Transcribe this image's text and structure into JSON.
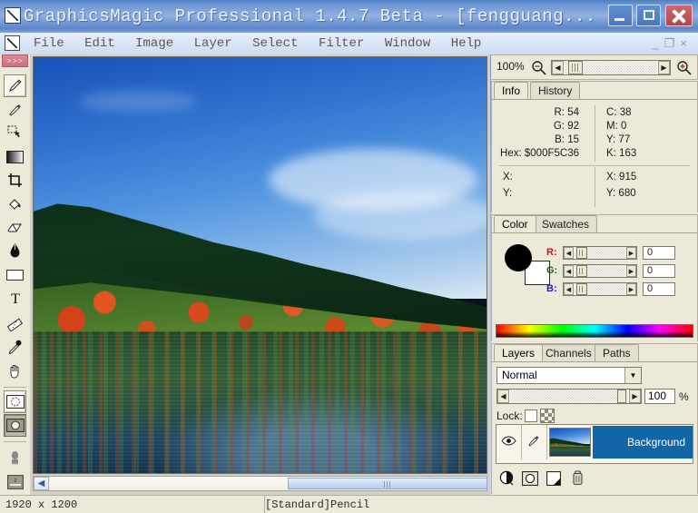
{
  "window": {
    "title": "GraphicsMagic Professional 1.4.7 Beta - [fengguang...",
    "minimize_label": "Minimize",
    "maximize_label": "Maximize",
    "close_label": "Close",
    "titlebar_color": "#6e96d4"
  },
  "menubar": {
    "items": [
      {
        "label": "File",
        "accel": "F"
      },
      {
        "label": "Edit",
        "accel": "E"
      },
      {
        "label": "Image",
        "accel": "I"
      },
      {
        "label": "Layer",
        "accel": "L"
      },
      {
        "label": "Select",
        "accel": "S"
      },
      {
        "label": "Filter",
        "accel": "t"
      },
      {
        "label": "Window",
        "accel": "W"
      },
      {
        "label": "Help",
        "accel": "H"
      }
    ],
    "mdi_minimize": "_",
    "mdi_restore": "❐",
    "mdi_close": "×"
  },
  "toolbox": {
    "grip_label": ">>>",
    "tools": [
      {
        "name": "pencil-tool",
        "icon": "pencil-icon",
        "selected": true
      },
      {
        "name": "brush-tool",
        "icon": "brush-icon",
        "selected": false
      },
      {
        "name": "move-tool",
        "icon": "move-icon",
        "selected": false
      },
      {
        "name": "gradient-tool",
        "icon": "gradient-icon",
        "selected": false
      },
      {
        "name": "crop-tool",
        "icon": "crop-icon",
        "selected": false
      },
      {
        "name": "paint-bucket-tool",
        "icon": "paint-bucket-icon",
        "selected": false
      },
      {
        "name": "eraser-tool",
        "icon": "eraser-icon",
        "selected": false
      },
      {
        "name": "blur-tool",
        "icon": "blur-drop-icon",
        "selected": false
      },
      {
        "name": "rectangle-tool",
        "icon": "rectangle-icon",
        "selected": false
      },
      {
        "name": "text-tool",
        "icon": "text-t-icon",
        "selected": false
      },
      {
        "name": "measure-tool",
        "icon": "ruler-icon",
        "selected": false
      },
      {
        "name": "eyedropper-tool",
        "icon": "eyedropper-icon",
        "selected": false
      },
      {
        "name": "hand-tool",
        "icon": "hand-icon",
        "selected": false
      },
      {
        "name": "quickmask-off-tool",
        "icon": "quickmask-off-icon",
        "selected": true
      },
      {
        "name": "quickmask-on-tool",
        "icon": "quickmask-on-icon",
        "pressed": true
      },
      {
        "name": "screenmode-tool",
        "icon": "screen-mode-icon",
        "selected": false
      },
      {
        "name": "jumpto-tool",
        "icon": "jump-to-app-icon",
        "selected": false
      }
    ]
  },
  "document": {
    "image_name": "fengguang",
    "scroll_h_value": 62
  },
  "zoom_bar": {
    "percent": "100%",
    "zoom_out_icon": "magnifier-minus-icon",
    "zoom_in_icon": "magnifier-plus-icon",
    "slider_value": 12
  },
  "info_panel": {
    "tabs": [
      {
        "label": "Info",
        "active": true
      },
      {
        "label": "History",
        "active": false
      }
    ],
    "rgb": {
      "r_label": "R: 54",
      "g_label": "G: 92",
      "b_label": "B: 15",
      "hex_label": "Hex: $000F5C36"
    },
    "cmyk": {
      "c_label": "C: 38",
      "m_label": "M: 0",
      "y_label": "Y: 77",
      "k_label": "K: 163"
    },
    "coords_left": {
      "x_label": "X:",
      "y_label": "Y:"
    },
    "coords_right": {
      "x_label": "X: 915",
      "y_label": "Y: 680"
    }
  },
  "color_panel": {
    "tabs": [
      {
        "label": "Color",
        "active": true
      },
      {
        "label": "Swatches",
        "active": false
      }
    ],
    "foreground_color": "#000000",
    "background_color": "#ffffff",
    "channels": [
      {
        "label": "R:",
        "value": "0",
        "color": "#c01818"
      },
      {
        "label": "G:",
        "value": "0",
        "color": "#1a6b1a"
      },
      {
        "label": "B:",
        "value": "0",
        "color": "#2222b8"
      }
    ]
  },
  "layers_panel": {
    "tabs": [
      {
        "label": "Layers",
        "active": true
      },
      {
        "label": "Channels",
        "active": false
      },
      {
        "label": "Paths",
        "active": false
      }
    ],
    "blend_mode": "Normal",
    "blend_arrow": "▼",
    "opacity_value": "100",
    "opacity_unit": "%",
    "lock_label": "Lock:",
    "layers": [
      {
        "name": "Background",
        "visible": true,
        "eye_icon": "eye-icon",
        "brush_icon": "brush-icon"
      }
    ],
    "buttons": [
      {
        "name": "new-adjustment-layer-button",
        "icon": "half-circle-icon"
      },
      {
        "name": "add-layer-mask-button",
        "icon": "mask-circle-icon"
      },
      {
        "name": "new-layer-button",
        "icon": "new-page-icon"
      },
      {
        "name": "delete-layer-button",
        "icon": "trash-icon"
      }
    ]
  },
  "statusbar": {
    "dimensions": "1920 x 1200",
    "tool_status": "[Standard]Pencil"
  }
}
